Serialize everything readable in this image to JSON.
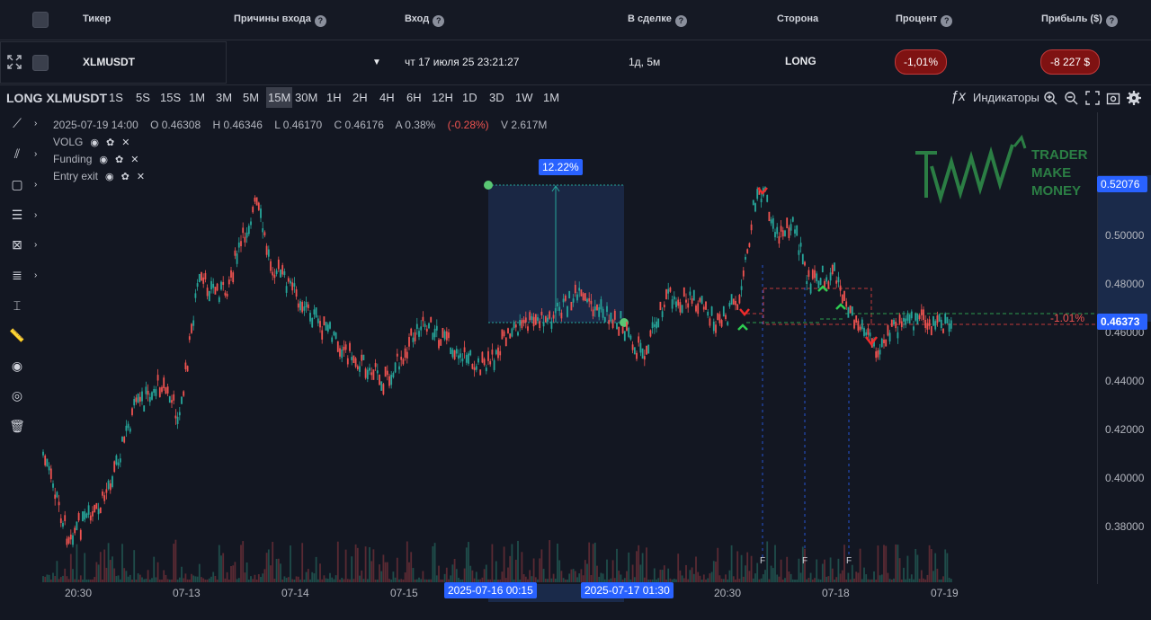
{
  "header": {
    "col_ticker": "Тикер",
    "col_reasons": "Причины входа",
    "col_entry": "Вход",
    "col_in_trade": "В сделке",
    "col_side": "Сторона",
    "col_percent": "Процент",
    "col_profit": "Прибыль ($)"
  },
  "trade": {
    "ticker": "XLMUSDT",
    "reasons": "",
    "entry": "чт 17 июля 25 23:21:27",
    "in_trade": "1д, 5м",
    "side": "LONG",
    "percent": "-1,01%",
    "profit": "-8 227 $"
  },
  "toolbar": {
    "symbol": "LONG XLMUSDT",
    "timeframes": [
      "1S",
      "5S",
      "15S",
      "1M",
      "3M",
      "5M",
      "15M",
      "30M",
      "1H",
      "2H",
      "4H",
      "6H",
      "12H",
      "1D",
      "3D",
      "1W",
      "1M"
    ],
    "active_tf": "15M",
    "indicators_label": "Индикаторы",
    "fx": "ƒx"
  },
  "legend": {
    "date": "2025-07-19 14:00",
    "o": "O 0.46308",
    "h": "H 0.46346",
    "l": "L 0.46170",
    "c": "C 0.46176",
    "a": "A 0.38%",
    "chg": "(-0.28%)",
    "v": "V 2.617M"
  },
  "indicators": [
    "VOLG",
    "Funding",
    "Entry exit"
  ],
  "price_axis": [
    "0.38000",
    "0.40000",
    "0.42000",
    "0.44000",
    "0.46000",
    "0.48000",
    "0.50000"
  ],
  "price_tags": {
    "high": "0.52076",
    "current": "0.46373"
  },
  "time_axis": [
    "20:30",
    "07-13",
    "07-14",
    "07-15",
    "20:30",
    "07-18",
    "07-19"
  ],
  "time_tags": [
    "2025-07-16 00:15",
    "2025-07-17 01:30"
  ],
  "measure_label": "12.22%",
  "loss_label": "-1.01%",
  "funding_marker": "F",
  "logo": "TRADER MAKE MONEY",
  "colors": {
    "up": "#26a69a",
    "down": "#ef5350",
    "bg": "#131722",
    "accent": "#2962ff"
  }
}
